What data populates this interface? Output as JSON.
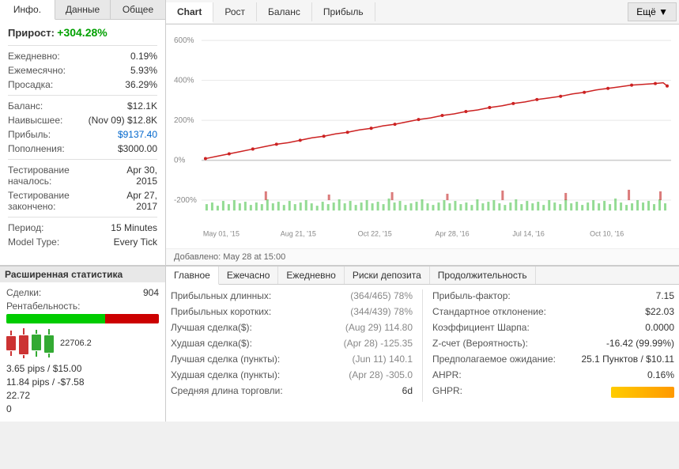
{
  "leftPanel": {
    "tabs": [
      "Инфо.",
      "Данные",
      "Общее"
    ],
    "activeTab": "Инфо.",
    "sectionTitle": "Прирост:",
    "growthValue": "+304.28%",
    "stats": [
      {
        "label": "Ежедневно:",
        "value": "0.19%"
      },
      {
        "label": "Ежемесячно:",
        "value": "5.93%"
      },
      {
        "label": "Просадка:",
        "value": "36.29%"
      }
    ],
    "financials": [
      {
        "label": "Баланс:",
        "value": "$12.1K",
        "type": "normal"
      },
      {
        "label": "Наивысшее:",
        "value": "(Nov 09) $12.8K",
        "type": "normal"
      },
      {
        "label": "Прибыль:",
        "value": "$9137.40",
        "type": "blue"
      },
      {
        "label": "Пополнения:",
        "value": "$3000.00",
        "type": "normal"
      }
    ],
    "testingStart": {
      "label": "Тестирование началось:",
      "value": "Apr 30, 2015"
    },
    "testingEnd": {
      "label": "Тестирование закончено:",
      "value": "Apr 27, 2017"
    },
    "period": {
      "label": "Период:",
      "value": "15 Minutes"
    },
    "modelType": {
      "label": "Model Type:",
      "value": "Every Tick"
    }
  },
  "chartPanel": {
    "tabs": [
      "Chart",
      "Рост",
      "Баланс",
      "Прибыль"
    ],
    "activeTab": "Chart",
    "moreButton": "Ещё ▼",
    "yLabels": [
      "600%",
      "400%",
      "200%",
      "0%",
      "-200%"
    ],
    "xLabels": [
      "May 01, '15",
      "Aug 21, '15",
      "Oct 22, '15",
      "Apr 28, '16",
      "Jul 14, '16",
      "Oct 10, '16"
    ],
    "addedLabel": "Добавлено:",
    "addedValue": "May 28 at 15:00"
  },
  "bottomLeft": {
    "header": "Расширенная статистика",
    "trades": {
      "label": "Сделки:",
      "value": "904"
    },
    "profitability": {
      "label": "Рентабельность:"
    },
    "progressGreenWidth": "65%",
    "progressRedWidth": "35%",
    "progressRedLeft": "65%",
    "stat1": {
      "value": "22706.2"
    },
    "stat2": {
      "value": "3.65 pips / $15.00"
    },
    "stat3": {
      "value": "11.84 pips / -$7.58"
    },
    "stat4": {
      "value": "22.72"
    },
    "stat5": {
      "value": "0"
    }
  },
  "bottomTabs": {
    "tabs": [
      "Главное",
      "Ежечасно",
      "Ежедневно",
      "Риски депозита",
      "Продолжительность"
    ],
    "activeTab": "Главное"
  },
  "mainStats": {
    "col1": [
      {
        "label": "Прибыльных длинных:",
        "value": "(364/465) 78%"
      },
      {
        "label": "Прибыльных коротких:",
        "value": "(344/439) 78%"
      },
      {
        "label": "Лучшая сделка($):",
        "value": "(Aug 29) 114.80"
      },
      {
        "label": "Худшая сделка($):",
        "value": "(Apr 28) -125.35",
        "gray": true
      },
      {
        "label": "Лучшая сделка (пункты):",
        "value": "(Jun 11) 140.1"
      },
      {
        "label": "Худшая сделка (пункты):",
        "value": "(Apr 28) -305.0",
        "gray": true
      },
      {
        "label": "Средняя длина торговли:",
        "value": "6d"
      }
    ],
    "col2": [
      {
        "label": "Прибыль-фактор:",
        "value": "7.15"
      },
      {
        "label": "Стандартное отклонение:",
        "value": "$22.03"
      },
      {
        "label": "Коэффициент Шарпа:",
        "value": "0.0000"
      },
      {
        "label": "Z-счет (Вероятность):",
        "value": "-16.42 (99.99%)"
      },
      {
        "label": "Предполагаемое ожидание:",
        "value": "25.1 Пунктов / $10.11"
      },
      {
        "label": "AHPR:",
        "value": "0.16%"
      },
      {
        "label": "GHPR:",
        "value": ""
      }
    ]
  }
}
